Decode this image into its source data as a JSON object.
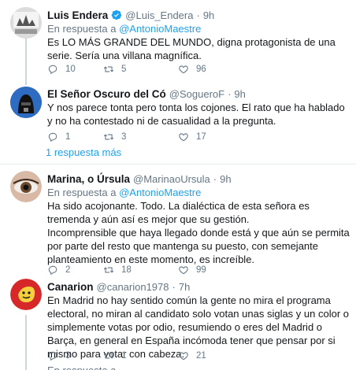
{
  "tweets": [
    {
      "name": "Luis Endera",
      "handle": "@Luis_Endera",
      "sep": "·",
      "time": "9h",
      "reply_prefix": "En respuesta a",
      "reply_mention": "@AntonioMaestre",
      "text": "Es LO MÁS GRANDE DEL MUNDO, digna protagonista de una serie. Sería una villana magnífica.",
      "replies": "10",
      "retweets": "5",
      "likes": "96"
    },
    {
      "name": "El Señor Oscuro del Có",
      "handle": "@SogueroF",
      "sep": "·",
      "time": "9h",
      "text": "Y nos parece tonta pero tonta los cojones. El rato que ha hablado y no ha contestado ni de casualidad a la pregunta.",
      "replies": "1",
      "retweets": "3",
      "likes": "17"
    },
    {
      "name": "Marina, o Úrsula",
      "handle": "@MarinaoUrsula",
      "sep": "·",
      "time": "9h",
      "reply_prefix": "En respuesta a",
      "reply_mention": "@AntonioMaestre",
      "text_lines": [
        "Ha sido acojonante. Todo. La dialéctica de esta señora es tremenda y aún así es mejor que su gestión.",
        "Incomprensible que haya llegado donde está y que aún se permita por parte del resto que mantenga su puesto,  con semejante planteamiento en este momento, es increíble."
      ],
      "replies": "2",
      "retweets": "18",
      "likes": "99"
    },
    {
      "name": "Canarion",
      "handle": "@canarion1978",
      "sep": "·",
      "time": "7h",
      "text": "En Madrid no hay sentido común la gente no mira el programa electoral, no miran al candidato solo votan unas siglas y un color o simplemente votas por odio, resumiendo o eres del Madrid o Barça, en general en España incómoda tener que pensar por si mismo para votar con cabeza.",
      "replies": "3",
      "retweets": "1",
      "likes": "21",
      "reply_prefix_partial": "En respuesta a"
    }
  ],
  "more_replies": "1 respuesta más",
  "colors": {
    "accent": "#1da1f2",
    "muted": "#657786",
    "divider": "#e6ecf0"
  }
}
